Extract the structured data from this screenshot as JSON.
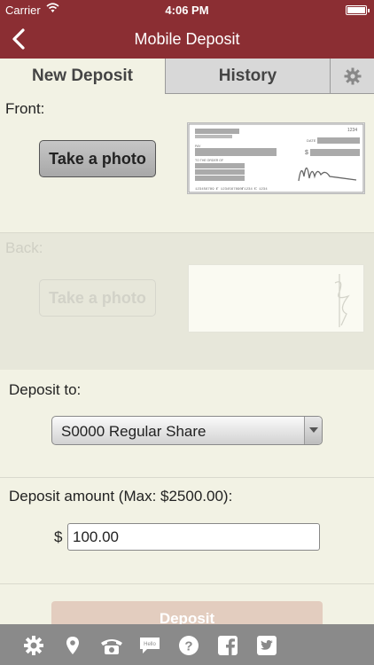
{
  "status": {
    "carrier": "Carrier",
    "time": "4:06 PM"
  },
  "nav": {
    "title": "Mobile Deposit"
  },
  "tabs": {
    "new_deposit": "New Deposit",
    "history": "History"
  },
  "front": {
    "label": "Front:",
    "button": "Take a photo"
  },
  "back": {
    "label": "Back:",
    "button": "Take a photo"
  },
  "check": {
    "number": "1234",
    "pay_to": "TO THE ORDER OF",
    "date": "DATE",
    "pay": "PAY",
    "dollar": "$",
    "micr": "123456789 ⑈ 1234567890⑈1234 ⑆ 1234"
  },
  "deposit_to": {
    "label": "Deposit to:",
    "selected": "S0000 Regular Share"
  },
  "amount": {
    "label": "Deposit amount (Max: $2500.00):",
    "currency": "$",
    "value": "100.00"
  },
  "deposit_button": "Deposit",
  "toolbar": [
    "gear-icon",
    "location-pin-icon",
    "phone-icon",
    "chat-hello-icon",
    "help-icon",
    "facebook-icon",
    "twitter-icon"
  ],
  "colors": {
    "brand": "#8b2e33",
    "background": "#f2f2e4",
    "toolbar": "#8a8a8a"
  }
}
